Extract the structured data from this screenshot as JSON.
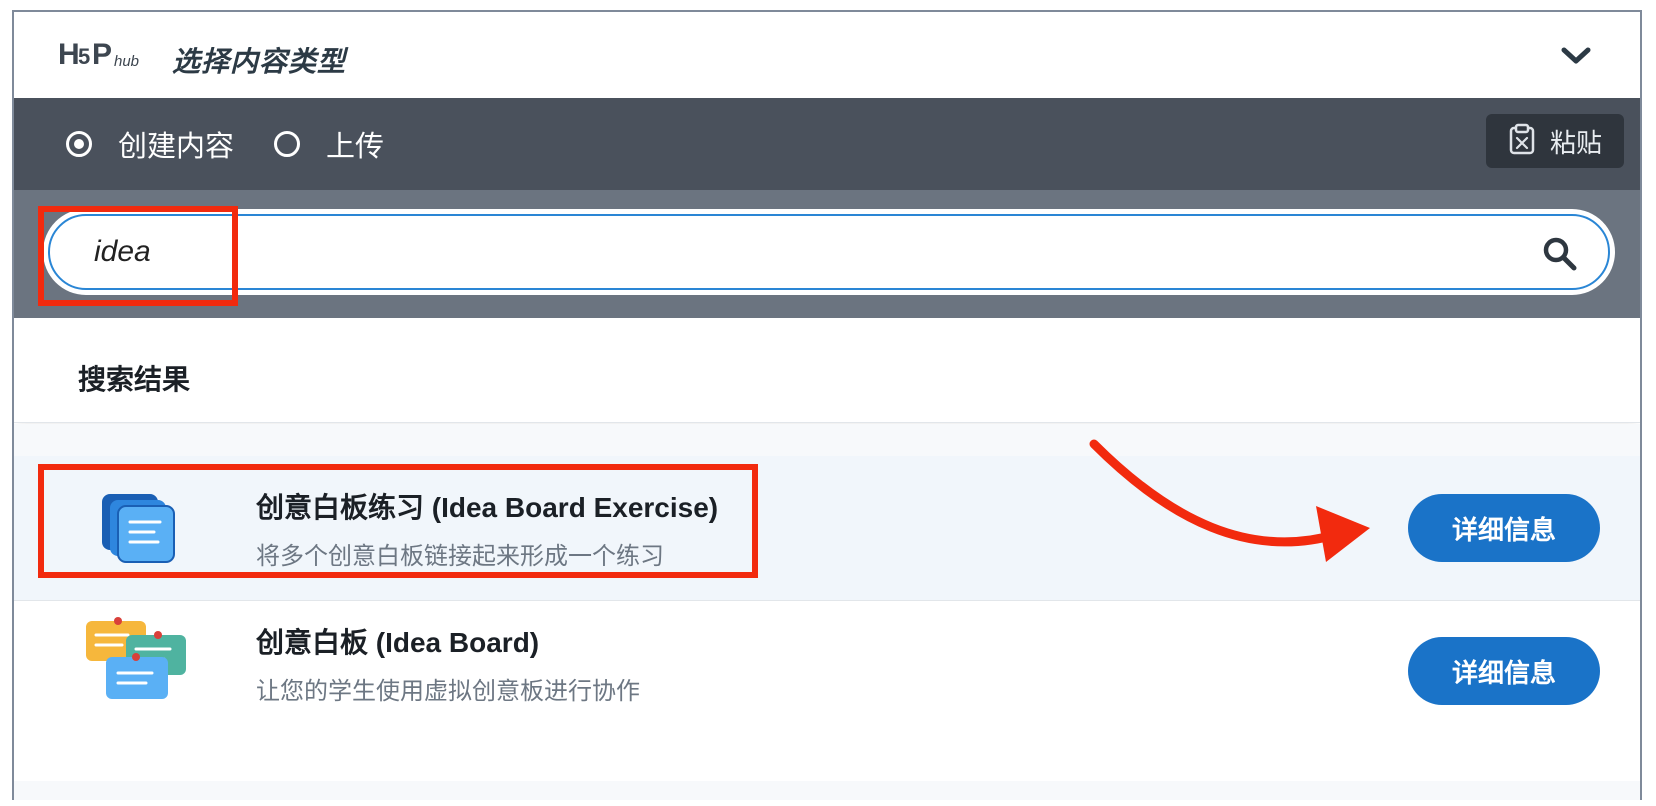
{
  "header": {
    "logo_text": "H5P hub",
    "title": "选择内容类型",
    "collapse_icon": "chevron-down-icon"
  },
  "mode": {
    "options": [
      {
        "label": "创建内容",
        "checked": true
      },
      {
        "label": "上传",
        "checked": false
      }
    ],
    "paste_label": "粘贴",
    "paste_icon": "clipboard-icon"
  },
  "search": {
    "value": "idea",
    "icon": "search-icon"
  },
  "results": {
    "title": "搜索结果",
    "items": [
      {
        "title": "创意白板练习 (Idea Board Exercise)",
        "description": "将多个创意白板链接起来形成一个练习",
        "button": "详细信息",
        "icon": "idea-board-exercise-icon"
      },
      {
        "title": "创意白板 (Idea Board)",
        "description": "让您的学生使用虚拟创意板进行协作",
        "button": "详细信息",
        "icon": "idea-board-icon"
      }
    ]
  },
  "colors": {
    "annotation": "#f22a0e",
    "button": "#1a73c8",
    "mode_bar": "#4a515c",
    "search_area": "#6b7480"
  }
}
